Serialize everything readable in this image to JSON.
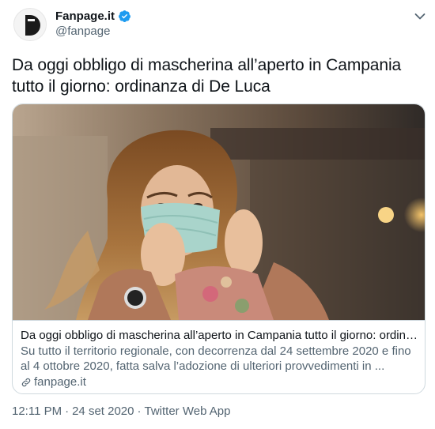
{
  "author": {
    "display_name": "Fanpage.it",
    "handle": "@fanpage",
    "verified_icon": "verified-badge-icon",
    "avatar_icon": "fanpage-logo-icon"
  },
  "menu_icon": "chevron-down-icon",
  "tweet": {
    "text": "Da oggi obbligo di mascherina all’aperto in Campania tutto il giorno: ordinanza di De Luca"
  },
  "card": {
    "image": "photo-woman-putting-on-face-mask",
    "title": "Da oggi obbligo di mascherina all’aperto in Campania tutto il giorno: ordina...",
    "description": "Su tutto il territorio regionale, con decorrenza dal 24 settembre 2020 e fino al 4 ottobre 2020, fatta salva l’adozione di ulteriori provvedimenti in ...",
    "domain": "fanpage.it",
    "domain_icon": "link-icon"
  },
  "meta": {
    "time": "12:11 PM",
    "separator": "·",
    "date": "24 set 2020",
    "source": "Twitter Web App"
  },
  "colors": {
    "text_primary": "#0f1419",
    "text_secondary": "#536471",
    "verified": "#1d9bf0",
    "border": "#cfd9de"
  }
}
